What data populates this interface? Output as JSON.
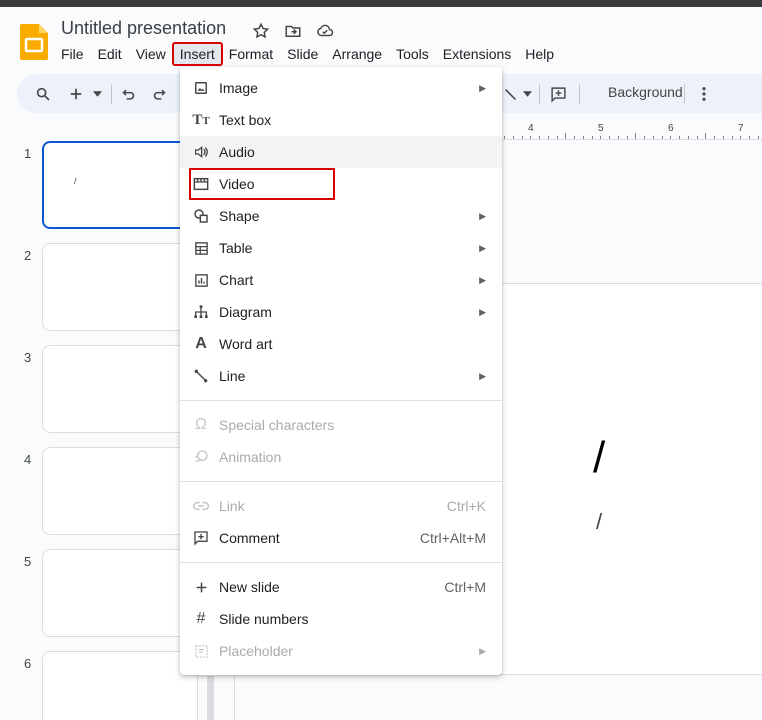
{
  "app": {
    "title": "Untitled presentation"
  },
  "menubar": [
    "File",
    "Edit",
    "View",
    "Insert",
    "Format",
    "Slide",
    "Arrange",
    "Tools",
    "Extensions",
    "Help"
  ],
  "toolbar": {
    "background_label": "Background"
  },
  "slides": [
    "1",
    "2",
    "3",
    "4",
    "5",
    "6"
  ],
  "thumb_text": "/",
  "ruler": [
    "4",
    "5",
    "6",
    "7"
  ],
  "canvas": {
    "title": "/",
    "subtitle": "/"
  },
  "insert_menu": {
    "groups": [
      [
        {
          "label": "Image",
          "icon": "image-icon",
          "submenu": true
        },
        {
          "label": "Text box",
          "icon": "text-box-icon"
        },
        {
          "label": "Audio",
          "icon": "audio-icon",
          "hover": true
        },
        {
          "label": "Video",
          "icon": "video-icon",
          "highlighted": true
        },
        {
          "label": "Shape",
          "icon": "shape-icon",
          "submenu": true
        },
        {
          "label": "Table",
          "icon": "table-icon",
          "submenu": true
        },
        {
          "label": "Chart",
          "icon": "chart-icon",
          "submenu": true
        },
        {
          "label": "Diagram",
          "icon": "diagram-icon",
          "submenu": true
        },
        {
          "label": "Word art",
          "icon": "word-art-icon"
        },
        {
          "label": "Line",
          "icon": "line-icon",
          "submenu": true
        }
      ],
      [
        {
          "label": "Special characters",
          "icon": "omega-icon",
          "disabled": true
        },
        {
          "label": "Animation",
          "icon": "animation-icon",
          "disabled": true
        }
      ],
      [
        {
          "label": "Link",
          "icon": "link-icon",
          "disabled": true,
          "shortcut": "Ctrl+K"
        },
        {
          "label": "Comment",
          "icon": "comment-icon",
          "shortcut": "Ctrl+Alt+M"
        }
      ],
      [
        {
          "label": "New slide",
          "icon": "plus-icon",
          "shortcut": "Ctrl+M"
        },
        {
          "label": "Slide numbers",
          "icon": "hash-icon"
        },
        {
          "label": "Placeholder",
          "icon": "placeholder-icon",
          "disabled": true,
          "submenu": true
        }
      ]
    ]
  }
}
